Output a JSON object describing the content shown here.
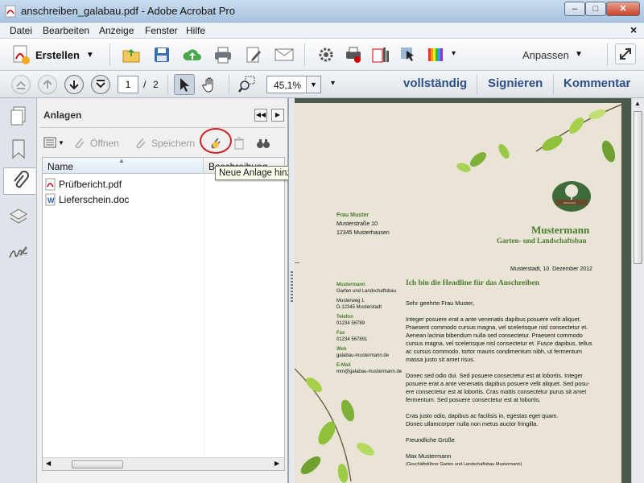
{
  "window": {
    "title": "anschreiben_galabau.pdf - Adobe Acrobat Pro",
    "minimize": "–",
    "maximize": "□",
    "close": "✕"
  },
  "menu": {
    "items": [
      "Datei",
      "Bearbeiten",
      "Anzeige",
      "Fenster",
      "Hilfe"
    ],
    "close": "×"
  },
  "toolbar": {
    "create_label": "Erstellen",
    "customize_label": "Anpassen"
  },
  "nav": {
    "page_current": "1",
    "page_sep": "/",
    "page_total": "2",
    "zoom": "45,1%",
    "links": [
      "vollständig",
      "Signieren",
      "Kommentar"
    ]
  },
  "panel": {
    "title": "Anlagen",
    "open_label": "Öffnen",
    "save_label": "Speichern",
    "columns": [
      "Name",
      "Beschreibung"
    ],
    "tooltip": "Neue Anlage hinzufügen",
    "files": [
      {
        "name": "Prüfbericht.pdf",
        "type": "pdf"
      },
      {
        "name": "Lieferschein.doc",
        "type": "doc"
      }
    ]
  },
  "letter": {
    "recipient": [
      "Frau Muster",
      "Musterstraße 10",
      "12345 Musterhausen"
    ],
    "company": "Mustermann",
    "company_sub": "Garten- und Landschaftsbau",
    "logo_text": "Mustermann",
    "date": "Musterstadt, 10. Dezember 2012",
    "headline": "Ich bin die Headline für das Anschreiben",
    "salutation": "Sehr geehrte Frau Muster,",
    "para1": [
      "Integer posuere erat a ante venenatis dapibus posuere velit aliquet.",
      "Praesent commodo cursus magna, vel scelerisque nisl consectetur et.",
      "Aenean lacinia bibendum nulla sed consectetur. Praesent commodo",
      "cursus magna, vel scelerisque nisl consectetur et. Fusce dapibus, tellus",
      "ac cursus commodo, tortor mauris condimentum nibh, ut fermentum",
      "massa justo sit amet risus."
    ],
    "para2": [
      "Donec sed odio dui. Sed posuere consectetur est at lobortis. Integer",
      "posuere erat a ante venenatis dapibus posuere velit aliquet. Sed posu-",
      "ere consectetur est at lobortis.  Cras mattis consectetur purus sit amet",
      "fermentum. Sed posuere consectetur est at lobortis."
    ],
    "para3": [
      "Cras justo odio, dapibus ac facilisis in, egestas eget quam.",
      "Donec ullamcorper nulla non metus auctor fringilla."
    ],
    "closing": "Freundliche Grüße",
    "signer": "Max Mustermann",
    "signer_role": "(Geschäftsführer Garten und Landschaftsbau Mustermann)",
    "sender": {
      "name": "Mustermann",
      "sub": "Garten und Landschaftsbau",
      "addr1": "Musterweg 1",
      "addr2": "D-12345 Musterstadt",
      "tel_label": "Telefon",
      "tel": "01234 56789",
      "fax_label": "Fax",
      "fax": "01234 567891",
      "web_label": "Web",
      "web": "galabau-mustermann.de",
      "mail_label": "E-Mail",
      "mail": "mm@galabau-mustermann.de"
    }
  },
  "colors": {
    "link": "#2d4f86",
    "green": "#4a7a2e",
    "highlight_ring": "#cc2222"
  }
}
